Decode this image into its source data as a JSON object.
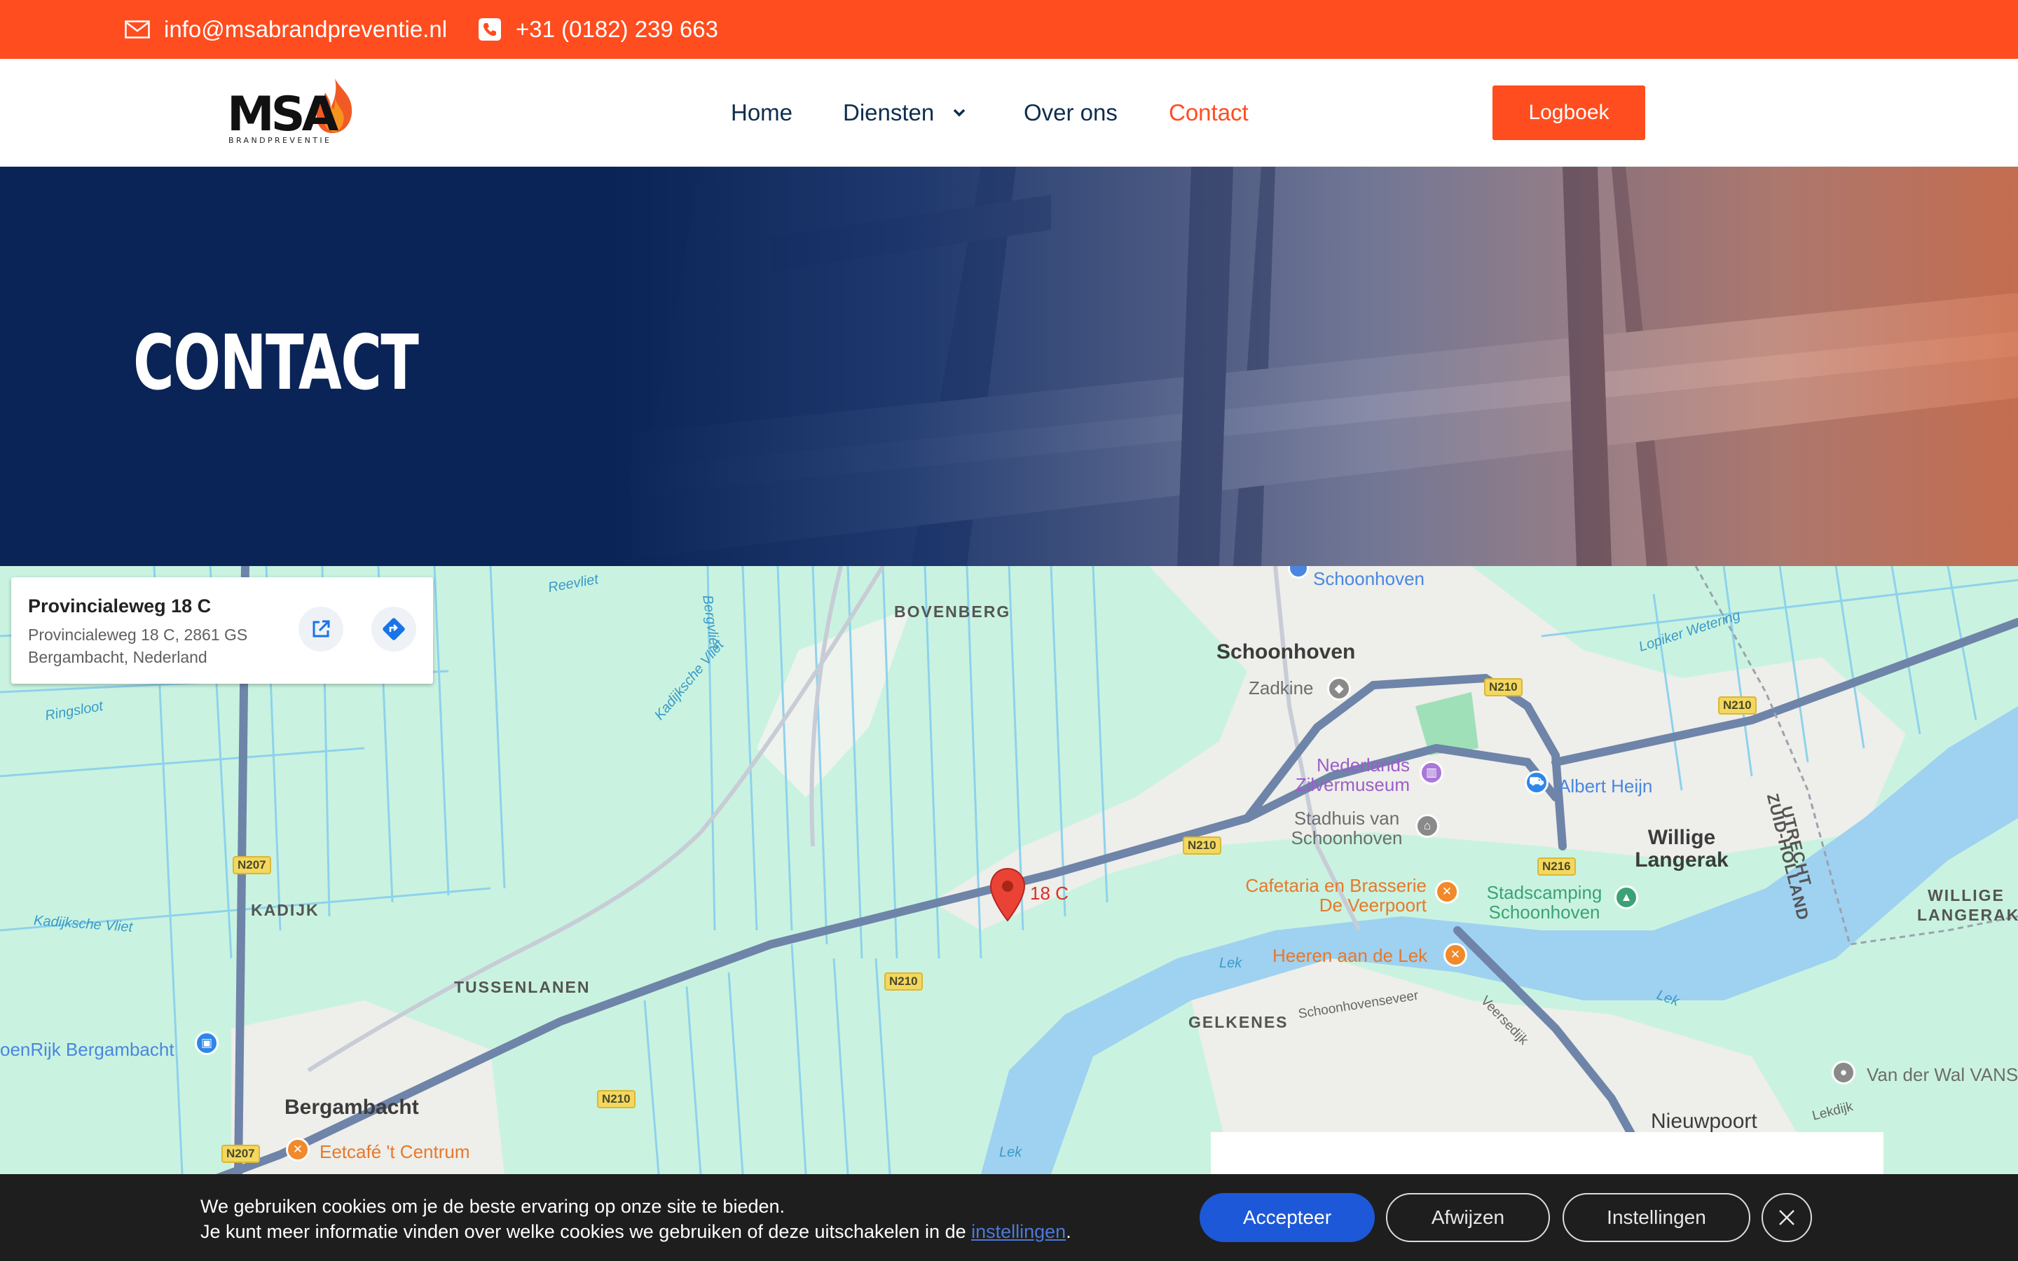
{
  "topbar": {
    "email": "info@msabrandpreventie.nl",
    "phone": "+31 (0182) 239 663"
  },
  "header": {
    "logo_text": "MSA",
    "logo_subtext": "BRANDPREVENTIE",
    "nav": [
      {
        "label": "Home",
        "active": false
      },
      {
        "label": "Diensten",
        "active": false,
        "has_dropdown": true
      },
      {
        "label": "Over ons",
        "active": false
      },
      {
        "label": "Contact",
        "active": true
      }
    ],
    "cta_label": "Logboek"
  },
  "hero": {
    "title": "CONTACT"
  },
  "map": {
    "place_card": {
      "title": "Provincialeweg 18 C",
      "address": "Provincialeweg 18 C, 2861 GS Bergambacht, Nederland"
    },
    "marker_label": "18 C",
    "labels": {
      "schoonhoven_top": "Schoonhoven",
      "bovenberg": "BOVENBERG",
      "schoonhoven": "Schoonhoven",
      "zadkine": "Zadkine",
      "zilvermuseum": "Nederlands Zilvermuseum",
      "albert_heijn": "Albert Heijn",
      "stadhuis": "Stadhuis van Schoonhoven",
      "willige_langerak": "Willige Langerak",
      "willige_langerak_caps": "WILLIGE LANGERAK",
      "cafetaria": "Cafetaria en Brasserie De Veerpoort",
      "stadscamping": "Stadscamping Schoonhoven",
      "heeren": "Heeren aan de Lek",
      "kadijk": "KADIJK",
      "tussenlanen": "TUSSENLANEN",
      "gelkenes": "GELKENES",
      "groenrijk": "oenRijk Bergambacht",
      "bergambacht": "Bergambacht",
      "eetcafe": "Eetcafé 't Centrum",
      "nieuwpoort": "Nieuwpoort",
      "vanderwal": "Van der Wal VANS",
      "utrecht": "UTRECHT",
      "zuid_holland": "ZUID-HOLLAND",
      "lek1": "Lek",
      "lek2": "Lek",
      "lek3": "Lek",
      "reevliet": "Reevliet",
      "bergvliet": "Bergvliet",
      "ringsloot": "Ringsloot",
      "kadijksche_vliet": "Kadijksche Vliet",
      "kadijksche_vliet2": "Kadijksche Vliet",
      "lopiker": "Lopiker Wetering",
      "schoonhovenseveer": "Schoonhovenseveer",
      "veersedijk": "Veersedijk",
      "lekdijk": "Lekdijk"
    },
    "road_badges": {
      "n210a": "N210",
      "n210b": "N210",
      "n210c": "N210",
      "n210d": "N210",
      "n210e": "N210",
      "n216": "N216",
      "n207a": "N207",
      "n207b": "N207"
    }
  },
  "cookie": {
    "line1": "We gebruiken cookies om je de beste ervaring op onze site te bieden.",
    "line2_prefix": "Je kunt meer informatie vinden over welke cookies we gebruiken of deze uitschakelen in de ",
    "line2_link": "instellingen",
    "line2_suffix": ".",
    "accept_label": "Accepteer",
    "reject_label": "Afwijzen",
    "settings_label": "Instellingen"
  },
  "colors": {
    "brand_orange": "#ff4d1f",
    "navy": "#0a2457",
    "accept_blue": "#1d58d8"
  }
}
